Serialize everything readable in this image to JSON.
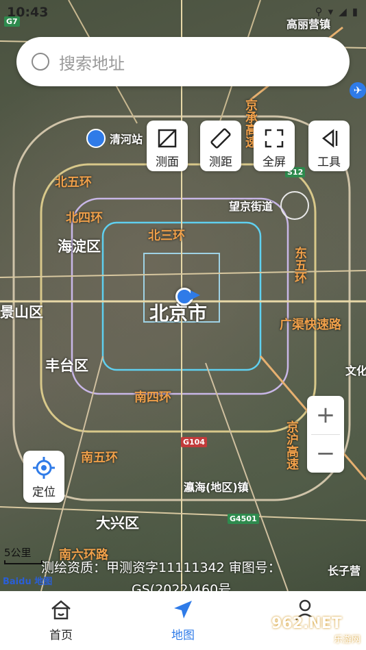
{
  "status": {
    "time": "10:43"
  },
  "search": {
    "placeholder": "搜索地址"
  },
  "tools": [
    {
      "label": "测面",
      "icon": "measure-area-icon"
    },
    {
      "label": "测距",
      "icon": "measure-distance-icon"
    },
    {
      "label": "全屏",
      "icon": "fullscreen-icon"
    },
    {
      "label": "工具",
      "icon": "tools-icon"
    }
  ],
  "zoom": {
    "in": "+",
    "out": "−"
  },
  "locate": {
    "label": "定位"
  },
  "map_labels": {
    "city": "北京市",
    "districts": [
      "海淀区",
      "丰台区",
      "大兴区",
      "景山区"
    ],
    "rings": [
      "北五环",
      "北四环",
      "北三环",
      "南四环",
      "南五环",
      "东五环",
      "京承高速",
      "广渠快速路",
      "京沪高速",
      "南六环路"
    ],
    "places": [
      "清河站",
      "望京街道",
      "高丽营镇",
      "瀛海(地区)镇",
      "长子营",
      "文化"
    ],
    "shields": [
      "G7",
      "G104",
      "G4501",
      "S12"
    ]
  },
  "scale": {
    "label": "5公里"
  },
  "brand": {
    "baidu": "Baidu",
    "map": "地图"
  },
  "copyright": {
    "line1": "测绘资质：甲测资字11111342  审图号：",
    "line2": "GS(2022)460号"
  },
  "tabs": [
    {
      "label": "首页",
      "icon": "home-icon",
      "active": false
    },
    {
      "label": "地图",
      "icon": "navigation-arrow-icon",
      "active": true
    },
    {
      "label": "",
      "icon": "person-icon",
      "active": false
    }
  ],
  "watermark": {
    "text": "962.NET",
    "sub": "乐游网"
  },
  "colors": {
    "accent": "#2f7be8",
    "ring_label": "#f0a04a",
    "tab_text": "#222222"
  }
}
